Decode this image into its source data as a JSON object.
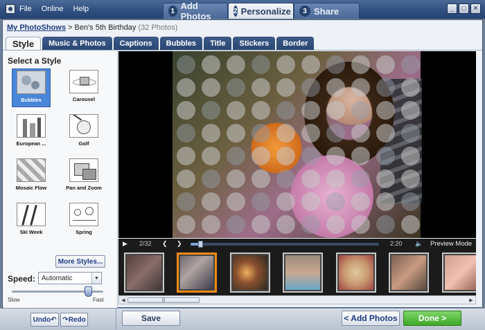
{
  "menu": [
    "File",
    "Online",
    "Help"
  ],
  "steps": [
    {
      "num": "1",
      "label": "Add Photos"
    },
    {
      "num": "2",
      "label": "Personalize"
    },
    {
      "num": "3",
      "label": "Share"
    }
  ],
  "window_controls": [
    "_",
    "□",
    "✕"
  ],
  "breadcrumb": {
    "link": "My PhotoShows",
    "separator": " > ",
    "title": "Ben's 5th Birthday",
    "count": "(32 Photos)"
  },
  "tabs": [
    "Style",
    "Music & Photos",
    "Captions",
    "Bubbles",
    "Title",
    "Stickers",
    "Border"
  ],
  "active_tab": "Style",
  "left": {
    "heading": "Select a Style",
    "styles": [
      "Bubbles",
      "Carousel",
      "European ...",
      "Golf",
      "Mosaic Flow",
      "Pan and Zoom",
      "Ski Week",
      "Spring"
    ],
    "selected_style": "Bubbles",
    "more_styles": "More Styles...",
    "speed_label": "Speed:",
    "speed_value": "Automatic",
    "speed_level_fraction": 0.83,
    "slow": "Slow",
    "fast": "Fast"
  },
  "player": {
    "counter": "2/32",
    "time": "2:20",
    "preview_mode": "Preview Mode",
    "progress_fraction": 0.05
  },
  "bottom": {
    "undo": "Undo",
    "redo": "Redo",
    "save": "Save",
    "add_photos": "< Add Photos",
    "done": "Done >"
  },
  "colors": {
    "accent_blue": "#2f4f7f",
    "selected_style": "#4a86d8",
    "done_green": "#3ea829",
    "selected_frame": "#f08a14"
  },
  "icons": [
    "app-icon",
    "play-icon",
    "prev-icon",
    "next-icon",
    "volume-icon",
    "undo-icon",
    "redo-icon",
    "dropdown-arrow-icon"
  ]
}
